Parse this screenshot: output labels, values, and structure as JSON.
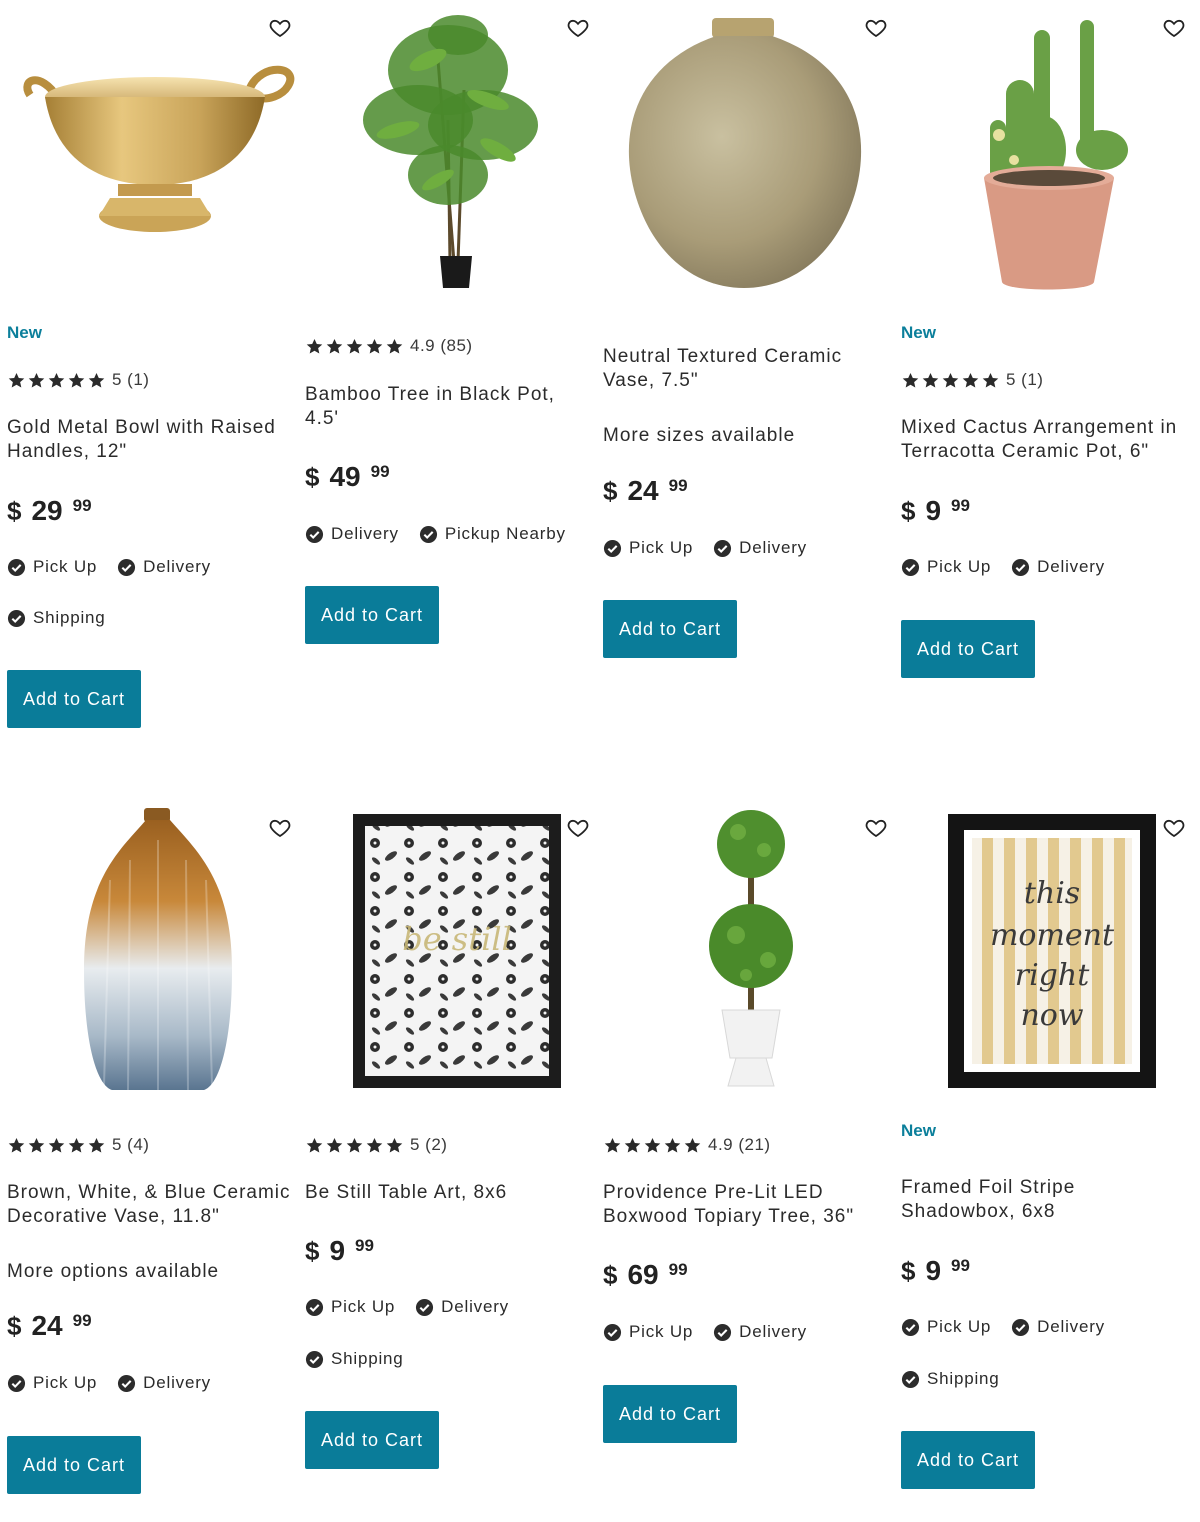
{
  "theme": {
    "accent": "#0a7c99",
    "badge": "#0b7f9b"
  },
  "products": [
    {
      "badge": "New",
      "rating_text": "5 (1)",
      "title": "Gold Metal Bowl with Raised Handles, 12\"",
      "more": "",
      "price_symbol": "$",
      "price_dollars": "29",
      "price_cents": "99",
      "options": [
        "Pick Up",
        "Delivery"
      ],
      "options2": [
        "Shipping"
      ],
      "cart_label": "Add to Cart",
      "icon": "gold-bowl-image"
    },
    {
      "badge": "",
      "rating_text": "4.9 (85)",
      "title": "Bamboo Tree in Black Pot, 4.5'",
      "more": "",
      "price_symbol": "$",
      "price_dollars": "49",
      "price_cents": "99",
      "options": [
        "Delivery",
        "Pickup Nearby"
      ],
      "options2": [],
      "cart_label": "Add to Cart",
      "icon": "bamboo-tree-image"
    },
    {
      "badge": "",
      "rating_text": "",
      "title": "Neutral Textured Ceramic Vase, 7.5\"",
      "more": "More sizes available",
      "price_symbol": "$",
      "price_dollars": "24",
      "price_cents": "99",
      "options": [
        "Pick Up",
        "Delivery"
      ],
      "options2": [],
      "cart_label": "Add to Cart",
      "icon": "ceramic-vase-image"
    },
    {
      "badge": "New",
      "rating_text": "5 (1)",
      "title": "Mixed Cactus Arrangement in Terracotta Ceramic Pot, 6\"",
      "more": "",
      "price_symbol": "$",
      "price_dollars": "9",
      "price_cents": "99",
      "options": [
        "Pick Up",
        "Delivery"
      ],
      "options2": [],
      "cart_label": "Add to Cart",
      "icon": "cactus-pot-image"
    },
    {
      "badge": "",
      "rating_text": "5 (4)",
      "title": "Brown, White, & Blue Ceramic Decorative Vase, 11.8\"",
      "more": "More options available",
      "price_symbol": "$",
      "price_dollars": "24",
      "price_cents": "99",
      "options": [
        "Pick Up",
        "Delivery"
      ],
      "options2": [],
      "cart_label": "Add to Cart",
      "icon": "ombre-vase-image"
    },
    {
      "badge": "",
      "rating_text": "5 (2)",
      "title": "Be Still Table Art, 8x6",
      "more": "",
      "price_symbol": "$",
      "price_dollars": "9",
      "price_cents": "99",
      "options": [
        "Pick Up",
        "Delivery"
      ],
      "options2": [
        "Shipping"
      ],
      "cart_label": "Add to Cart",
      "icon": "be-still-art-image",
      "art_text": "be still"
    },
    {
      "badge": "",
      "rating_text": "4.9 (21)",
      "title": "Providence Pre-Lit LED Boxwood Topiary Tree, 36\"",
      "more": "",
      "price_symbol": "$",
      "price_dollars": "69",
      "price_cents": "99",
      "options": [
        "Pick Up",
        "Delivery"
      ],
      "options2": [],
      "cart_label": "Add to Cart",
      "icon": "topiary-tree-image"
    },
    {
      "badge": "New",
      "rating_text": "",
      "title": "Framed Foil Stripe Shadowbox, 6x8",
      "more": "",
      "price_symbol": "$",
      "price_dollars": "9",
      "price_cents": "99",
      "options": [
        "Pick Up",
        "Delivery"
      ],
      "options2": [
        "Shipping"
      ],
      "cart_label": "Add to Cart",
      "icon": "stripe-shadowbox-image",
      "art_lines": [
        "this",
        "moment",
        "right",
        "now"
      ]
    }
  ]
}
